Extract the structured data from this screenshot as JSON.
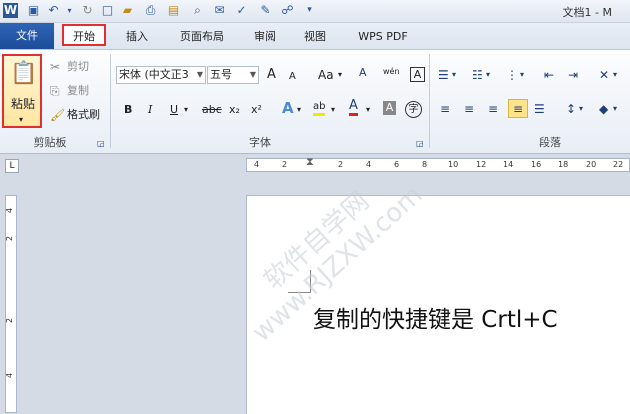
{
  "window": {
    "doc_title": "文档1 - M"
  },
  "quick_access": [
    "W",
    "save-icon",
    "undo-icon",
    "redo-icon",
    "new-icon",
    "open-icon",
    "print-icon",
    "folder-icon",
    "preview-icon",
    "spell-icon",
    "edit-icon",
    "tree-icon"
  ],
  "tabs": {
    "file": "文件",
    "home": "开始",
    "insert": "插入",
    "page_layout": "页面布局",
    "review": "审阅",
    "view": "视图",
    "wps_pdf": "WPS PDF"
  },
  "clipboard": {
    "paste": "粘贴",
    "cut": "剪切",
    "copy": "复制",
    "format_painter": "格式刷",
    "group": "剪贴板"
  },
  "font": {
    "font_name": "宋体 (中文正3",
    "font_size": "五号",
    "group": "字体",
    "bold": "B",
    "italic": "I",
    "underline": "U",
    "strike": "abc",
    "sub": "x₂",
    "sup": "x²",
    "grow": "A",
    "shrink": "A",
    "case": "Aa",
    "clear": "A",
    "phonetic": "wén",
    "border": "A",
    "color_a": "A",
    "highlight": "ab",
    "char_shade": "A",
    "enclose": "字"
  },
  "paragraph": {
    "group": "段落"
  },
  "ruler": {
    "ticks": [
      "4",
      "2",
      "2",
      "4",
      "6",
      "8",
      "10",
      "12",
      "14",
      "16",
      "18",
      "20",
      "22"
    ]
  },
  "vruler": {
    "ticks": [
      "4",
      "2",
      "2",
      "4"
    ]
  },
  "document": {
    "text": "复制的快捷键是 Crtl+C"
  },
  "watermark": {
    "text": "软件自学网 www.RJZXW.com"
  },
  "colors": {
    "accent": "#1c4d9b",
    "highlight_border": "#e02f2f"
  }
}
